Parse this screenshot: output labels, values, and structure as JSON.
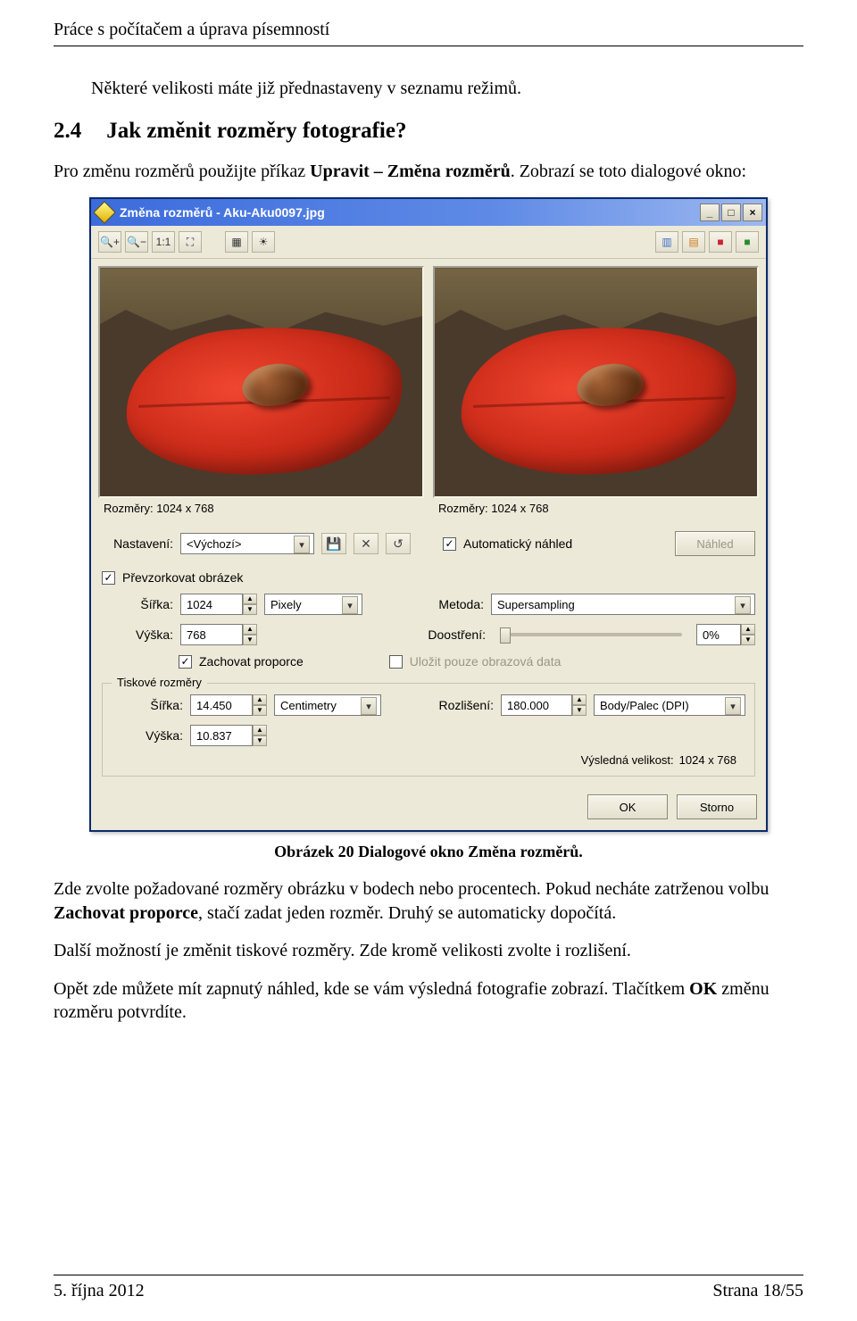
{
  "document": {
    "header": "Práce s počítačem a úprava písemností",
    "intro": "Některé velikosti máte již přednastaveny v seznamu režimů.",
    "section_number": "2.4",
    "section_title": "Jak změnit rozměry fotografie?",
    "para1_before": "Pro změnu rozměrů použijte příkaz ",
    "para1_bold": "Upravit – Změna rozměrů",
    "para1_after": ". Zobrazí se toto dialogové okno:",
    "caption": "Obrázek 20 Dialogové okno Změna rozměrů.",
    "para2_a": "Zde zvolte požadované rozměry obrázku v bodech nebo procentech. Pokud necháte zatrženou volbu ",
    "para2_b": "Zachovat proporce",
    "para2_c": ", stačí zadat jeden rozměr. Druhý se automaticky dopočítá.",
    "para3": "Další možností je změnit tiskové rozměry. Zde kromě velikosti zvolte i rozlišení.",
    "para4_a": "Opět zde můžete mít zapnutý náhled, kde se vám výsledná fotografie zobrazí. Tlačítkem ",
    "para4_b": "OK",
    "para4_c": " změnu rozměru potvrdíte.",
    "footer_left": "5. října 2012",
    "footer_right": "Strana 18/55"
  },
  "dialog": {
    "title": "Změna rozměrů - Aku-Aku0097.jpg",
    "winbtns": {
      "min": "_",
      "max": "□",
      "close": "×"
    },
    "toolbar_icons": {
      "zoom_in": "🔍+",
      "zoom_out": "🔍−",
      "one_to_one": "1:1",
      "fit": "⛶",
      "pic_a": "▦",
      "sun": "☀",
      "cmp_v": "▥",
      "cmp_h": "▤",
      "cmp_r": "■",
      "cmp_g": "■"
    },
    "left_preview_dims": "Rozměry: 1024 x 768",
    "right_preview_dims": "Rozměry: 1024 x 768",
    "settings_label": "Nastavení:",
    "settings_value": "<Výchozí>",
    "save_icon": "💾",
    "delete_icon": "✕",
    "undo_icon": "↺",
    "auto_preview_label": "Automatický náhled",
    "preview_btn": "Náhled",
    "resample_label": "Převzorkovat obrázek",
    "width_label": "Šířka:",
    "height_label": "Výška:",
    "width_value": "1024",
    "height_value": "768",
    "pixels_unit": "Pixely",
    "method_label": "Metoda:",
    "method_value": "Supersampling",
    "sharpen_label": "Doostření:",
    "sharpen_value": "0%",
    "keep_ratio_label": "Zachovat proporce",
    "save_only_label": "Uložit pouze obrazová data",
    "print_dims_legend": "Tiskové rozměry",
    "print_width": "14.450",
    "print_height": "10.837",
    "print_unit": "Centimetry",
    "resolution_label": "Rozlišení:",
    "resolution_value": "180.000",
    "resolution_unit": "Body/Palec (DPI)",
    "result_label": "Výsledná velikost:",
    "result_value": "1024 x 768",
    "ok_btn": "OK",
    "cancel_btn": "Storno"
  }
}
